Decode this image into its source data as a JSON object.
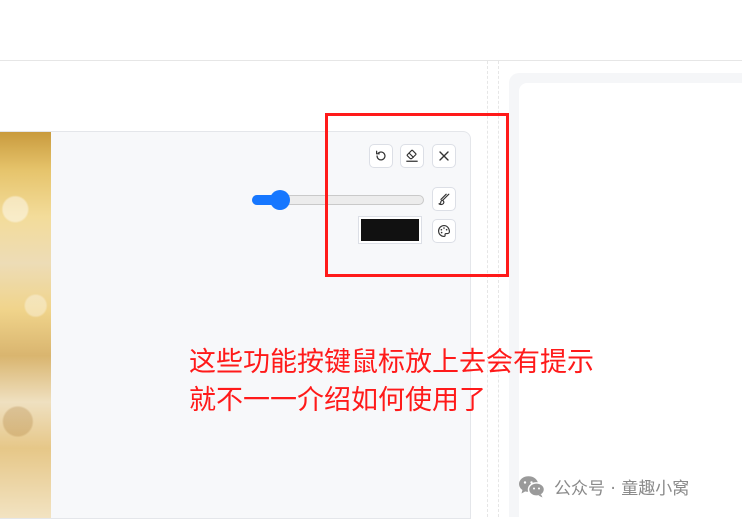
{
  "toolbar": {
    "undo_icon": "undo-icon",
    "eraser_icon": "eraser-icon",
    "close_icon": "close-icon",
    "brush_icon": "brush-icon",
    "palette_icon": "palette-icon"
  },
  "brush": {
    "size_fraction": 0.16,
    "color": "#111111"
  },
  "colors": {
    "accent": "#1677ff",
    "highlight": "#ff1a1a"
  },
  "annotation": {
    "line1": "这些功能按键鼠标放上去会有提示",
    "line2": "就不一一介绍如何使用了"
  },
  "watermark": {
    "icon": "wechat-icon",
    "text": "公众号 · 童趣小窝"
  }
}
